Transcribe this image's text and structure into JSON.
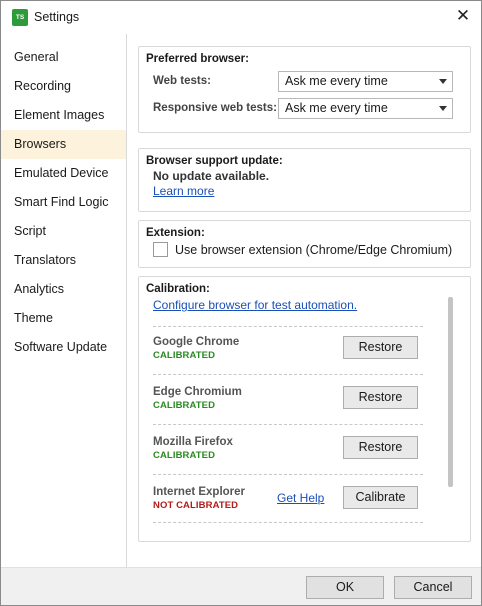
{
  "window": {
    "title": "Settings",
    "app_icon_text": "TS"
  },
  "sidebar": {
    "items": [
      {
        "label": "General"
      },
      {
        "label": "Recording"
      },
      {
        "label": "Element Images"
      },
      {
        "label": "Browsers"
      },
      {
        "label": "Emulated Device"
      },
      {
        "label": "Smart Find Logic"
      },
      {
        "label": "Script"
      },
      {
        "label": "Translators"
      },
      {
        "label": "Analytics"
      },
      {
        "label": "Theme"
      },
      {
        "label": "Software Update"
      }
    ],
    "active": "Browsers"
  },
  "preferred_browser": {
    "title": "Preferred browser:",
    "web_tests_label": "Web tests:",
    "web_tests_value": "Ask me every time",
    "responsive_label": "Responsive web tests:",
    "responsive_value": "Ask me every time"
  },
  "browser_support_update": {
    "title": "Browser support update:",
    "status": "No update available.",
    "learn_more": "Learn more"
  },
  "extension": {
    "title": "Extension:",
    "checkbox_label": "Use browser extension (Chrome/Edge Chromium)",
    "checked": false
  },
  "calibration": {
    "title": "Calibration:",
    "configure_link": "Configure browser for test automation.",
    "browsers": [
      {
        "name": "Google Chrome",
        "status": "CALIBRATED",
        "action": "Restore"
      },
      {
        "name": "Edge Chromium",
        "status": "CALIBRATED",
        "action": "Restore"
      },
      {
        "name": "Mozilla Firefox",
        "status": "CALIBRATED",
        "action": "Restore"
      },
      {
        "name": "Internet Explorer",
        "status": "NOT CALIBRATED",
        "help": "Get Help",
        "action": "Calibrate"
      }
    ]
  },
  "footer": {
    "ok_label": "OK",
    "cancel_label": "Cancel"
  },
  "colors": {
    "calibrated": "#2a8a22",
    "not_calibrated": "#b31b1b",
    "active_nav": "#fdf3dc",
    "link": "#1a4fb8"
  }
}
